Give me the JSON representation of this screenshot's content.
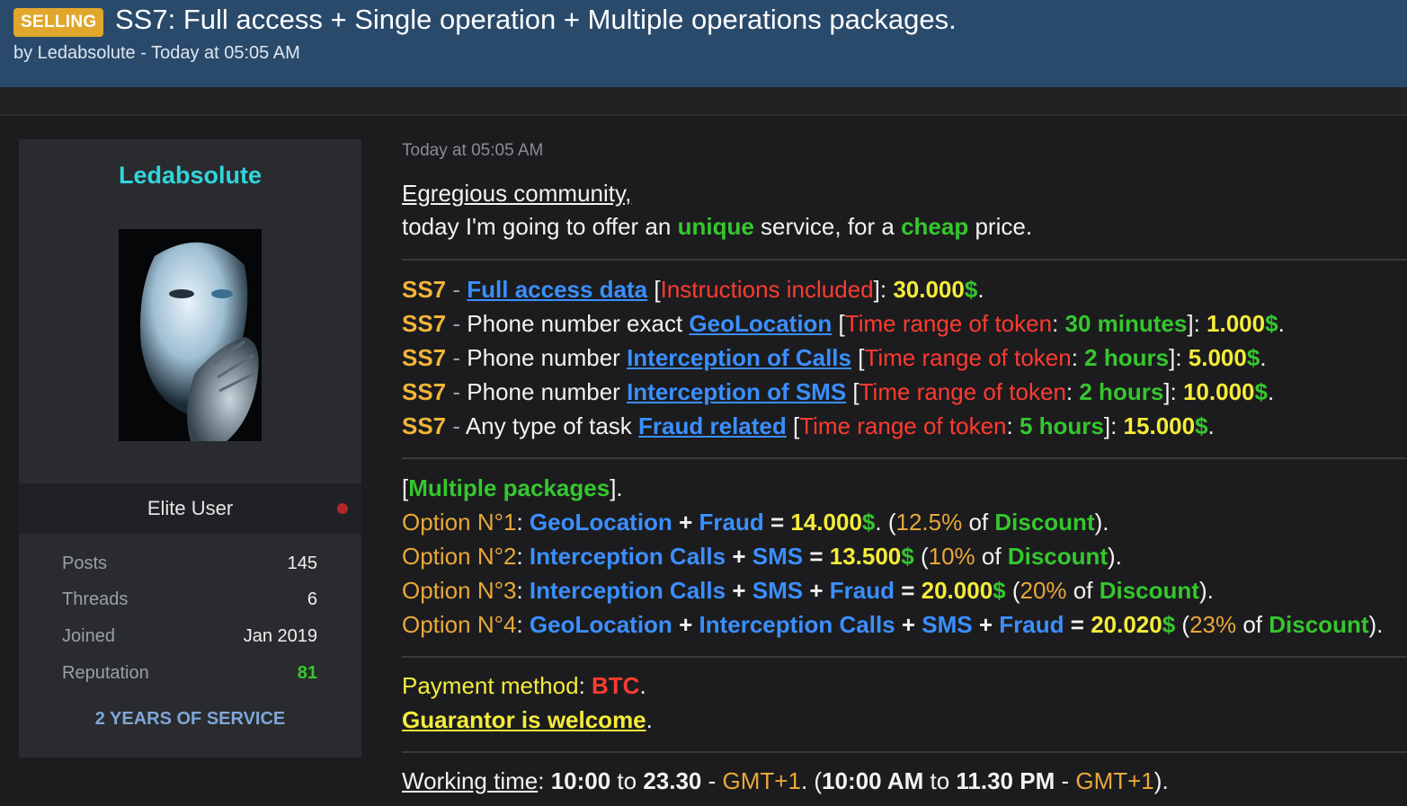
{
  "header": {
    "badge": "SELLING",
    "title": "SS7: Full access + Single operation + Multiple operations packages.",
    "byline": "by Ledabsolute - Today at 05:05 AM"
  },
  "sidebar": {
    "username": "Ledabsolute",
    "rank": "Elite User",
    "stats": [
      {
        "label": "Posts",
        "value": "145"
      },
      {
        "label": "Threads",
        "value": "6"
      },
      {
        "label": "Joined",
        "value": "Jan 2019"
      },
      {
        "label": "Reputation",
        "value": "81"
      }
    ],
    "service": "2 YEARS OF SERVICE"
  },
  "post": {
    "timestamp": "Today at 05:05 AM",
    "greeting": "Egregious community,",
    "intro": {
      "a": "today I'm going to offer an ",
      "unique": "unique",
      "b": " service, for a ",
      "cheap": "cheap",
      "c": " price."
    },
    "offers": [
      {
        "tag": "SS7",
        "sep": " - ",
        "prefix": "",
        "link": "Full access data",
        "range_label": "Instructions included",
        "range_value": "",
        "price": "30.000",
        "currency": "$"
      },
      {
        "tag": "SS7",
        "sep": " - ",
        "prefix": "Phone number exact ",
        "link": "GeoLocation",
        "range_label": "Time range of token",
        "range_value": "30 minutes",
        "price": "1.000",
        "currency": "$"
      },
      {
        "tag": "SS7",
        "sep": " - ",
        "prefix": "Phone number ",
        "link": "Interception of Calls",
        "range_label": "Time range of token",
        "range_value": "2 hours",
        "price": "5.000",
        "currency": "$"
      },
      {
        "tag": "SS7",
        "sep": " - ",
        "prefix": "Phone number ",
        "link": "Interception of SMS",
        "range_label": "Time range of token",
        "range_value": "2 hours",
        "price": "10.000",
        "currency": "$"
      },
      {
        "tag": "SS7",
        "sep": " - ",
        "prefix": "Any type of task ",
        "link": "Fraud related",
        "range_label": "Time range of token",
        "range_value": "5 hours",
        "price": "15.000",
        "currency": "$"
      }
    ],
    "packages_title": "Multiple packages",
    "options": [
      {
        "label": "Option N°1",
        "items": [
          "GeoLocation",
          "Fraud"
        ],
        "price": "14.000",
        "currency": "$",
        "pct": "12.5%",
        "of": " of ",
        "discount": "Discount",
        "dot_after_price": "."
      },
      {
        "label": "Option N°2",
        "items": [
          "Interception Calls",
          "SMS"
        ],
        "price": "13.500",
        "currency": "$",
        "pct": "10%",
        "of": " of ",
        "discount": "Discount",
        "dot_after_price": ""
      },
      {
        "label": "Option N°3",
        "items": [
          "Interception Calls",
          "SMS",
          "Fraud"
        ],
        "price": "20.000",
        "currency": "$",
        "pct": "20%",
        "of": " of ",
        "discount": "Discount",
        "dot_after_price": ""
      },
      {
        "label": "Option N°4",
        "items": [
          "GeoLocation",
          "Interception Calls",
          "SMS",
          "Fraud"
        ],
        "price": "20.020",
        "currency": "$",
        "pct": "23%",
        "of": " of ",
        "discount": "Discount",
        "dot_after_price": ""
      }
    ],
    "payment_label": "Payment method",
    "payment_value": "BTC",
    "guarantor": "Guarantor is welcome",
    "working": {
      "label": "Working time",
      "from": "10:00",
      "to_word": " to ",
      "to": "23.30",
      "tz": "GMT+1",
      "from12": "10:00 AM",
      "to12": "11.30 PM",
      "tz2": "GMT+1"
    }
  },
  "colors": {
    "header_bg": "#2a4a6b",
    "badge_bg": "#e0a72c",
    "username": "#2fd6dc",
    "link_blue": "#3b8fff",
    "green": "#35c72e",
    "red": "#ff3b30",
    "yellow": "#f5ec3a",
    "gold": "#f2b43a"
  }
}
